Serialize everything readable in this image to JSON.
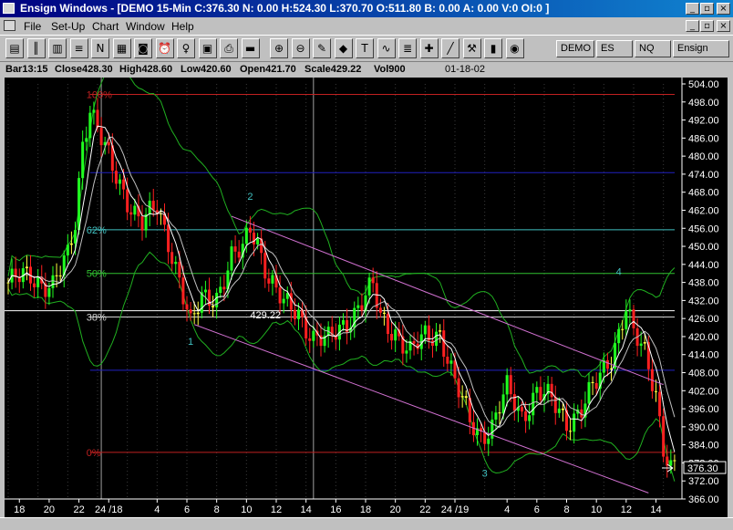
{
  "window": {
    "title": "Ensign Windows - [DEMO 15-Min C:376.30 N: 0.00 H:524.30 L:370.70 O:511.80 B: 0.00 A: 0.00 V:0 OI:0 ]",
    "minimize_glyph": "_",
    "restore_glyph": "▫",
    "close_glyph": "×"
  },
  "menu": {
    "items": [
      {
        "label": "File",
        "name": "menu-file"
      },
      {
        "label": "Set-Up",
        "name": "menu-setup"
      },
      {
        "label": "Chart",
        "name": "menu-chart"
      },
      {
        "label": "Window",
        "name": "menu-window"
      },
      {
        "label": "Help",
        "name": "menu-help"
      }
    ]
  },
  "toolbar": {
    "buttons": [
      {
        "name": "print-preview-icon",
        "glyph": "▤"
      },
      {
        "name": "bar-chart-icon",
        "glyph": "║"
      },
      {
        "name": "page-icon",
        "glyph": "▥"
      },
      {
        "name": "list-icon",
        "glyph": "≡"
      },
      {
        "name": "notes-icon",
        "glyph": "N"
      },
      {
        "name": "grid-icon",
        "glyph": "▦"
      },
      {
        "name": "camera-icon",
        "glyph": "◙"
      },
      {
        "name": "alarm-clock-icon",
        "glyph": "⏰"
      },
      {
        "name": "lightbulb-icon",
        "glyph": "♀"
      },
      {
        "name": "table-icon",
        "glyph": "▣"
      },
      {
        "name": "printer-icon",
        "glyph": "⎙"
      },
      {
        "name": "dde-icon",
        "glyph": "▬"
      },
      {
        "name": "zoom-in-icon",
        "glyph": "⊕"
      },
      {
        "name": "zoom-out-icon",
        "glyph": "⊖"
      },
      {
        "name": "chart-settings-icon",
        "glyph": "✎"
      },
      {
        "name": "color-icon",
        "glyph": "◆"
      },
      {
        "name": "text-icon",
        "glyph": "T"
      },
      {
        "name": "studies-icon",
        "glyph": "∿"
      },
      {
        "name": "quote-icon",
        "glyph": "≣"
      },
      {
        "name": "multi-tool-icon",
        "glyph": "✚"
      },
      {
        "name": "draw-line-icon",
        "glyph": "╱"
      },
      {
        "name": "draw-tools-icon",
        "glyph": "⚒"
      },
      {
        "name": "indicator-icon",
        "glyph": "▮"
      },
      {
        "name": "radar-icon",
        "glyph": "◉"
      }
    ],
    "symbol_tabs": [
      "DEMO",
      "ES",
      "NQ",
      "Ensign"
    ]
  },
  "info_bar": {
    "bar": "Bar13:15",
    "close": "Close428.30",
    "high": "High428.60",
    "low": "Low420.60",
    "open": "Open421.70",
    "scale": "Scale429.22",
    "vol": "Vol900",
    "date": "01-18-02"
  },
  "chart_data": {
    "type": "candlestick",
    "ylim": [
      366,
      504
    ],
    "y_ticks": [
      "504.00",
      "498.00",
      "492.00",
      "486.00",
      "480.00",
      "474.00",
      "468.00",
      "462.00",
      "456.00",
      "450.00",
      "444.00",
      "438.00",
      "432.00",
      "426.00",
      "420.00",
      "414.00",
      "408.00",
      "402.00",
      "396.00",
      "390.00",
      "384.00",
      "378.00",
      "372.00",
      "366.00"
    ],
    "x_ticks": [
      {
        "label": "18",
        "i": 3
      },
      {
        "label": "20",
        "i": 11
      },
      {
        "label": "22",
        "i": 19
      },
      {
        "label": "24 /18",
        "i": 27
      },
      {
        "label": "4",
        "i": 40
      },
      {
        "label": "6",
        "i": 48
      },
      {
        "label": "8",
        "i": 56
      },
      {
        "label": "10",
        "i": 64
      },
      {
        "label": "12",
        "i": 72
      },
      {
        "label": "14",
        "i": 80
      },
      {
        "label": "16",
        "i": 88
      },
      {
        "label": "18",
        "i": 96
      },
      {
        "label": "20",
        "i": 104
      },
      {
        "label": "22",
        "i": 112
      },
      {
        "label": "24 /19",
        "i": 120
      },
      {
        "label": "4",
        "i": 134
      },
      {
        "label": "6",
        "i": 142
      },
      {
        "label": "8",
        "i": 150
      },
      {
        "label": "10",
        "i": 158
      },
      {
        "label": "12",
        "i": 166
      },
      {
        "label": "14",
        "i": 174
      }
    ],
    "last_price": "376.30",
    "fib_levels": [
      {
        "label": "100%",
        "y": 500.5,
        "color": "#c02020"
      },
      {
        "label": "",
        "y": 474.5,
        "color": "#2020c0"
      },
      {
        "label": "62%",
        "y": 455.5,
        "color": "#40c0c0"
      },
      {
        "label": "50%",
        "y": 441.0,
        "color": "#30c030"
      },
      {
        "label": "",
        "y": 428.6,
        "color": "#ffffff"
      },
      {
        "label": "38%",
        "y": 426.5,
        "color": "#d0d0d0"
      },
      {
        "label": "",
        "y": 408.8,
        "color": "#2020c0"
      },
      {
        "label": "0%",
        "y": 381.5,
        "color": "#c02020"
      }
    ],
    "price_label": {
      "text": "429.22",
      "i": 65,
      "y": 427.2
    },
    "swing_labels": [
      {
        "text": "1",
        "i": 49,
        "y": 417.2
      },
      {
        "text": "2",
        "i": 65,
        "y": 465.5
      },
      {
        "text": "3",
        "i": 128,
        "y": 373.5
      },
      {
        "text": "4",
        "i": 164,
        "y": 440.5
      }
    ],
    "channel_lines": [
      {
        "name": "upper",
        "i1": 60,
        "y1": 460.0,
        "i2": 176,
        "y2": 404.0
      },
      {
        "name": "lower",
        "i1": 50,
        "y1": 424.0,
        "i2": 172,
        "y2": 368.0
      }
    ],
    "close_waypoints": [
      [
        0,
        438
      ],
      [
        6,
        440
      ],
      [
        12,
        437
      ],
      [
        16,
        446
      ],
      [
        18,
        458
      ],
      [
        20,
        485
      ],
      [
        22,
        497
      ],
      [
        24,
        489
      ],
      [
        28,
        475
      ],
      [
        32,
        466
      ],
      [
        36,
        458
      ],
      [
        40,
        462
      ],
      [
        43,
        452
      ],
      [
        46,
        440
      ],
      [
        49,
        423
      ],
      [
        52,
        432
      ],
      [
        56,
        434
      ],
      [
        60,
        446
      ],
      [
        63,
        448
      ],
      [
        65,
        456
      ],
      [
        67,
        452
      ],
      [
        70,
        440
      ],
      [
        74,
        430
      ],
      [
        78,
        428
      ],
      [
        82,
        420
      ],
      [
        86,
        418
      ],
      [
        90,
        424
      ],
      [
        94,
        430
      ],
      [
        98,
        436
      ],
      [
        100,
        426
      ],
      [
        104,
        422
      ],
      [
        108,
        414
      ],
      [
        112,
        420
      ],
      [
        116,
        422
      ],
      [
        120,
        404
      ],
      [
        124,
        392
      ],
      [
        127,
        388
      ],
      [
        130,
        390
      ],
      [
        134,
        402
      ],
      [
        138,
        394
      ],
      [
        142,
        402
      ],
      [
        146,
        398
      ],
      [
        150,
        392
      ],
      [
        154,
        396
      ],
      [
        158,
        404
      ],
      [
        162,
        414
      ],
      [
        166,
        430
      ],
      [
        168,
        420
      ],
      [
        171,
        414
      ],
      [
        174,
        402
      ],
      [
        176,
        384
      ],
      [
        178,
        376
      ]
    ]
  },
  "colors": {
    "chart_bg": "#000000",
    "up_bar": "#20ff20",
    "down_bar": "#ff2020",
    "neutral_bar": "#ffff40",
    "band": "#20b020",
    "ma_white": "#ffffff",
    "ma_light": "#c0c0c0",
    "channel": "#d070d0",
    "grid": "#3a3a3a",
    "axis_text": "#ffffff"
  }
}
